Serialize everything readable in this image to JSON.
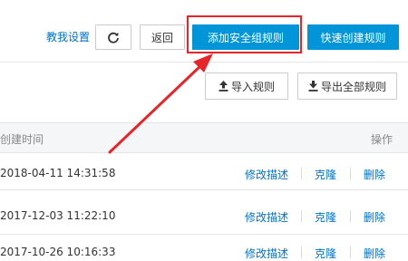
{
  "toolbar": {
    "teach_link": "教我设置",
    "back_label": "返回",
    "add_rule_label": "添加安全组规则",
    "quick_create_label": "快速创建规则",
    "refresh_icon": "refresh-icon"
  },
  "actions": {
    "import_label": "导入规则",
    "export_label": "导出全部规则",
    "import_icon": "upload-icon",
    "export_icon": "download-icon"
  },
  "table": {
    "headers": {
      "created_time": "创建时间",
      "actions": "操作"
    },
    "rows": [
      {
        "created": "2018-04-11 14:31:58",
        "edit": "修改描述",
        "clone": "克隆",
        "delete": "删除"
      },
      {
        "created": "2017-12-03 11:22:10",
        "edit": "修改描述",
        "clone": "克隆",
        "delete": "删除"
      },
      {
        "created": "2017-10-26 10:16:33",
        "edit": "修改描述",
        "clone": "克隆",
        "delete": "删除"
      }
    ]
  },
  "colors": {
    "primary": "#0095d9",
    "link": "#0070cc",
    "highlight_box": "#e8242b",
    "arrow": "#e8242b"
  }
}
